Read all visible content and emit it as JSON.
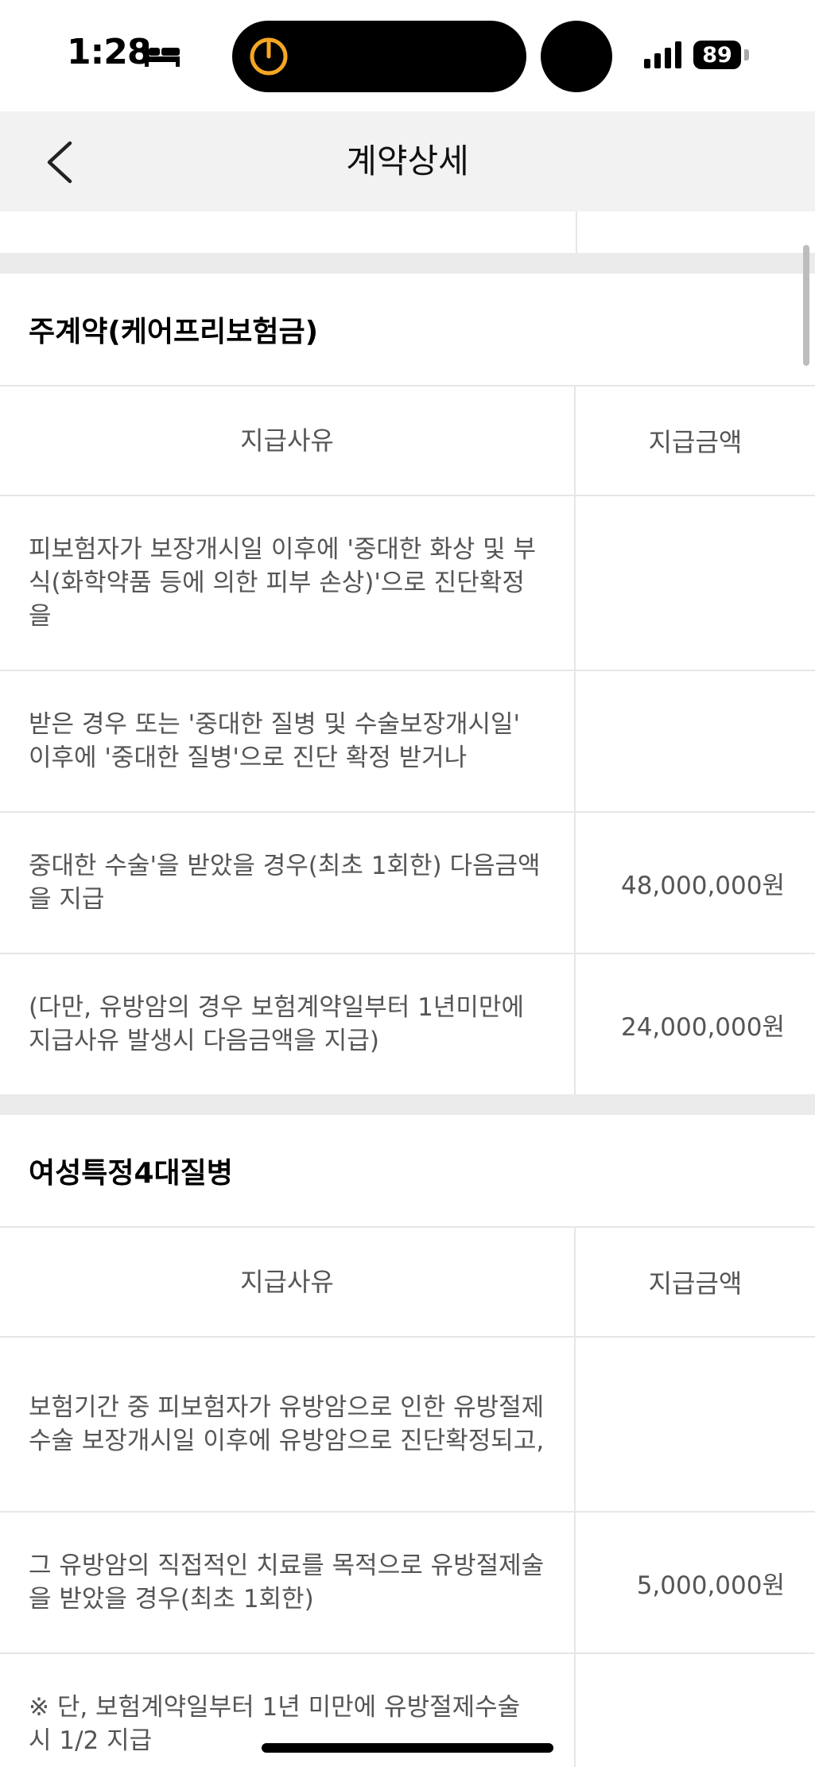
{
  "status_bar": {
    "time": "1:28",
    "battery": "89"
  },
  "nav": {
    "title": "계약상세"
  },
  "sections": [
    {
      "title": "주계약(케어프리보험금)",
      "header": {
        "reason": "지급사유",
        "amount": "지급금액"
      },
      "rows": [
        {
          "reason": "피보험자가 보장개시일 이후에 '중대한 화상 및 부식(화학약품 등에 의한 피부 손상)'으로 진단확정을",
          "amount": ""
        },
        {
          "reason": "받은 경우 또는 '중대한 질병 및 수술보장개시일' 이후에 '중대한 질병'으로 진단 확정 받거나",
          "amount": ""
        },
        {
          "reason": "중대한 수술'을 받았을 경우(최초 1회한) 다음금액을 지급",
          "amount": "48,000,000원"
        },
        {
          "reason": "(다만, 유방암의 경우 보험계약일부터 1년미만에 지급사유 발생시 다음금액을 지급)",
          "amount": "24,000,000원"
        }
      ]
    },
    {
      "title": "여성특정4대질병",
      "header": {
        "reason": "지급사유",
        "amount": "지급금액"
      },
      "rows": [
        {
          "reason": "보험기간 중 피보험자가 유방암으로 인한 유방절제수술 보장개시일 이후에 유방암으로 진단확정되고,",
          "amount": ""
        },
        {
          "reason": "그 유방암의 직접적인 치료를 목적으로 유방절제술을 받았을 경우(최초 1회한)",
          "amount": "5,000,000원"
        },
        {
          "reason": "※ 단, 보험계약일부터 1년 미만에 유방절제수술 시 1/2 지급",
          "amount": ""
        }
      ]
    }
  ]
}
